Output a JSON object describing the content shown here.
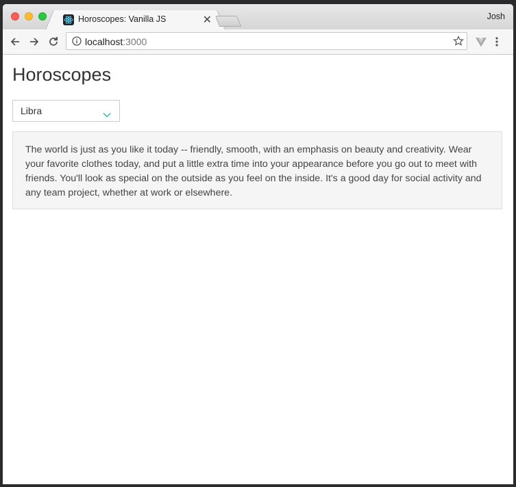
{
  "browser": {
    "tab_title": "Horoscopes: Vanilla JS",
    "profile_name": "Josh",
    "url_host": "localhost",
    "url_port": ":3000",
    "icons": {
      "favicon": "react-icon",
      "back": "arrow-left-icon",
      "forward": "arrow-right-icon",
      "reload": "reload-icon",
      "info": "info-icon",
      "bookmark": "star-icon",
      "extension": "vue-devtools-icon",
      "menu": "kebab-menu-icon"
    }
  },
  "page": {
    "title": "Horoscopes",
    "sign_select": {
      "selected": "Libra"
    },
    "horoscope_text": "The world is just as you like it today -- friendly, smooth, with an emphasis on beauty and creativity. Wear your favorite clothes today, and put a little extra time into your appearance before you go out to meet with friends. You'll look as special on the outside as you feel on the inside. It's a good day for social activity and any team project, whether at work or elsewhere."
  },
  "colors": {
    "accent_chevron": "#2ab5a3",
    "panel_bg": "#f5f5f5"
  }
}
